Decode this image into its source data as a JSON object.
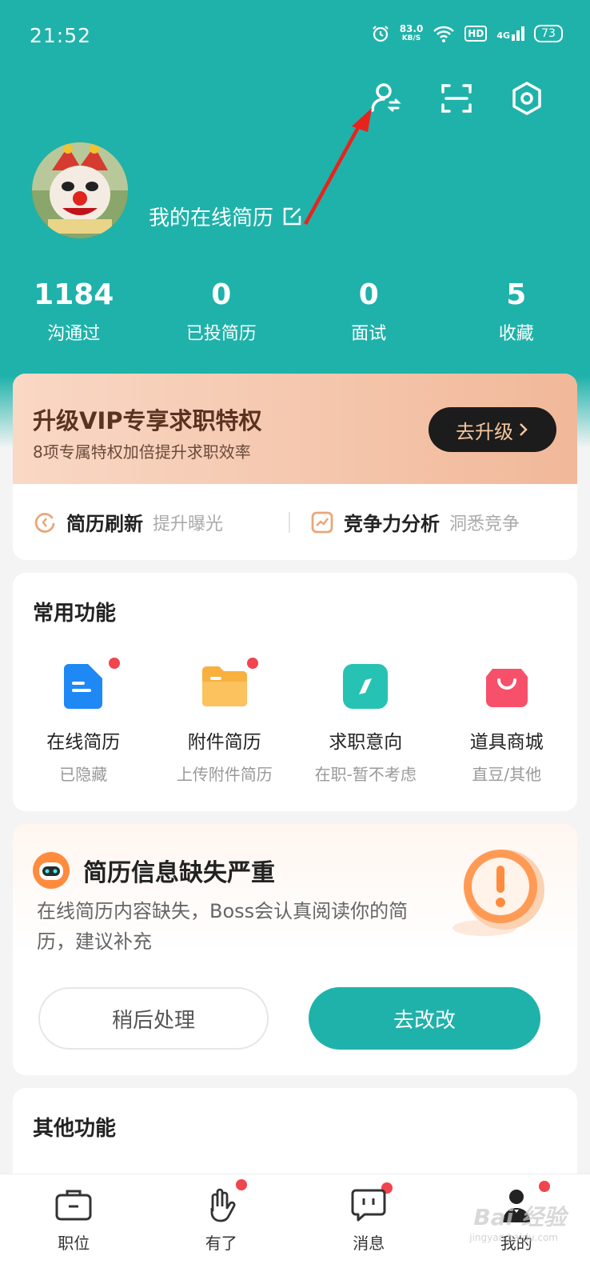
{
  "status_bar": {
    "time": "21:52",
    "net_speed": "83.0",
    "net_speed_unit": "KB/S",
    "hd": "HD",
    "network": "4G",
    "battery": "73"
  },
  "header": {
    "icons": [
      "switch-identity-icon",
      "scan-icon",
      "settings-icon"
    ]
  },
  "profile": {
    "resume_link": "我的在线简历"
  },
  "stats": [
    {
      "value": "1184",
      "label": "沟通过"
    },
    {
      "value": "0",
      "label": "已投简历"
    },
    {
      "value": "0",
      "label": "面试"
    },
    {
      "value": "5",
      "label": "收藏"
    }
  ],
  "vip": {
    "title": "升级VIP专享求职特权",
    "subtitle": "8项专属特权加倍提升求职效率",
    "button": "去升级",
    "features": [
      {
        "name": "简历刷新",
        "desc": "提升曝光"
      },
      {
        "name": "竞争力分析",
        "desc": "洞悉竞争"
      }
    ]
  },
  "common_functions": {
    "title": "常用功能",
    "items": [
      {
        "label": "在线简历",
        "sub": "已隐藏",
        "color": "#1e88f5"
      },
      {
        "label": "附件简历",
        "sub": "上传附件简历",
        "color": "#f9b03f"
      },
      {
        "label": "求职意向",
        "sub": "在职-暂不考虑",
        "color": "#26c2b4"
      },
      {
        "label": "道具商城",
        "sub": "直豆/其他",
        "color": "#f7506a"
      }
    ]
  },
  "resume_warning": {
    "title": "简历信息缺失严重",
    "text": "在线简历内容缺失，Boss会认真阅读你的简历，建议补充",
    "later_button": "稍后处理",
    "go_button": "去改改"
  },
  "other_functions": {
    "title": "其他功能"
  },
  "nav": [
    {
      "label": "职位",
      "icon": "briefcase-icon"
    },
    {
      "label": "有了",
      "icon": "hand-icon"
    },
    {
      "label": "消息",
      "icon": "message-icon"
    },
    {
      "label": "我的",
      "icon": "user-icon"
    }
  ],
  "watermark": {
    "text": "Bai 经验",
    "sub": "jingyan.baidu.com"
  },
  "colors": {
    "brand": "#1fb2aa",
    "dot": "#f0444f"
  }
}
